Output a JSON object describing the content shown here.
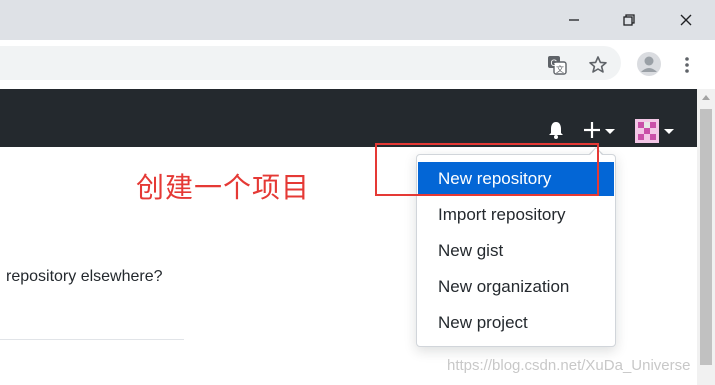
{
  "browser": {
    "window_controls": [
      "minimize",
      "maximize",
      "close"
    ],
    "toolbar_icons": [
      "translate-icon",
      "star-icon",
      "profile-icon",
      "menu-icon"
    ]
  },
  "header": {
    "icons": [
      "bell-icon",
      "plus-dropdown-icon",
      "avatar"
    ],
    "background": "#24292e"
  },
  "annotation": {
    "text": "创建一个项目",
    "color": "#e53935"
  },
  "page": {
    "elsewhere_text": "repository elsewhere?"
  },
  "dropdown": {
    "items": [
      {
        "label": "New repository",
        "active": true
      },
      {
        "label": "Import repository"
      },
      {
        "label": "New gist"
      },
      {
        "label": "New organization"
      },
      {
        "label": "New project"
      }
    ],
    "accent": "#0366d6"
  },
  "watermark": "https://blog.csdn.net/XuDa_Universe"
}
